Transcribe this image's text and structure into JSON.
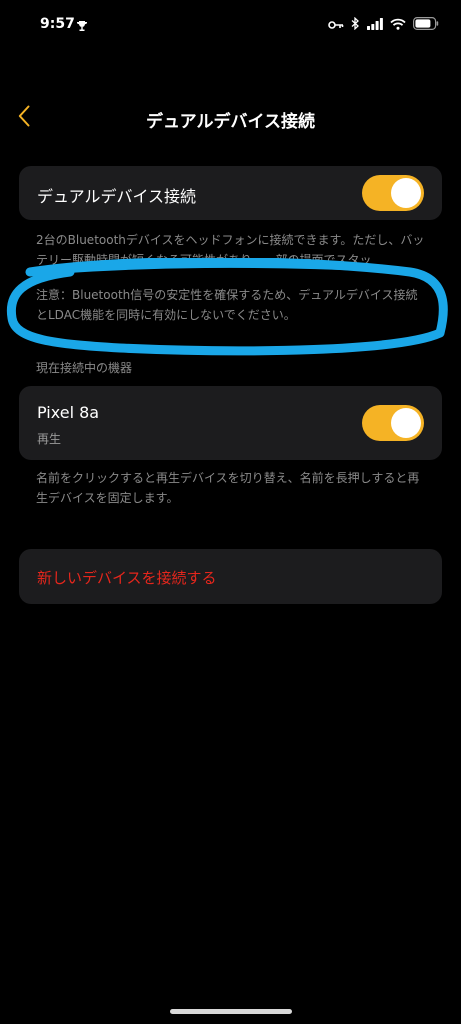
{
  "status_bar": {
    "time": "9:57"
  },
  "nav": {
    "title": "デュアルデバイス接続"
  },
  "dual_device": {
    "label": "デュアルデバイス接続",
    "enabled": true
  },
  "description_1": "2台のBluetoothデバイスをヘッドフォンに接続できます。ただし、バッテリー駆動時間が短くなる可能性があり、一部の場面でスタッ",
  "description_2": "注意：Bluetooth信号の安定性を確保するため、デュアルデバイス接続とLDAC機能を同時に有効にしないでください。",
  "connected_section": {
    "header": "現在接続中の機器",
    "device_name": "Pixel 8a",
    "device_status": "再生",
    "enabled": true
  },
  "description_3": "名前をクリックすると再生デバイスを切り替え、名前を長押しすると再生デバイスを固定します。",
  "new_device_label": "新しいデバイスを接続する",
  "colors": {
    "toggle_on": "#f5b325",
    "accent_back": "#f5b325",
    "destructive": "#e5261c",
    "marker": "#1aa7e8"
  }
}
